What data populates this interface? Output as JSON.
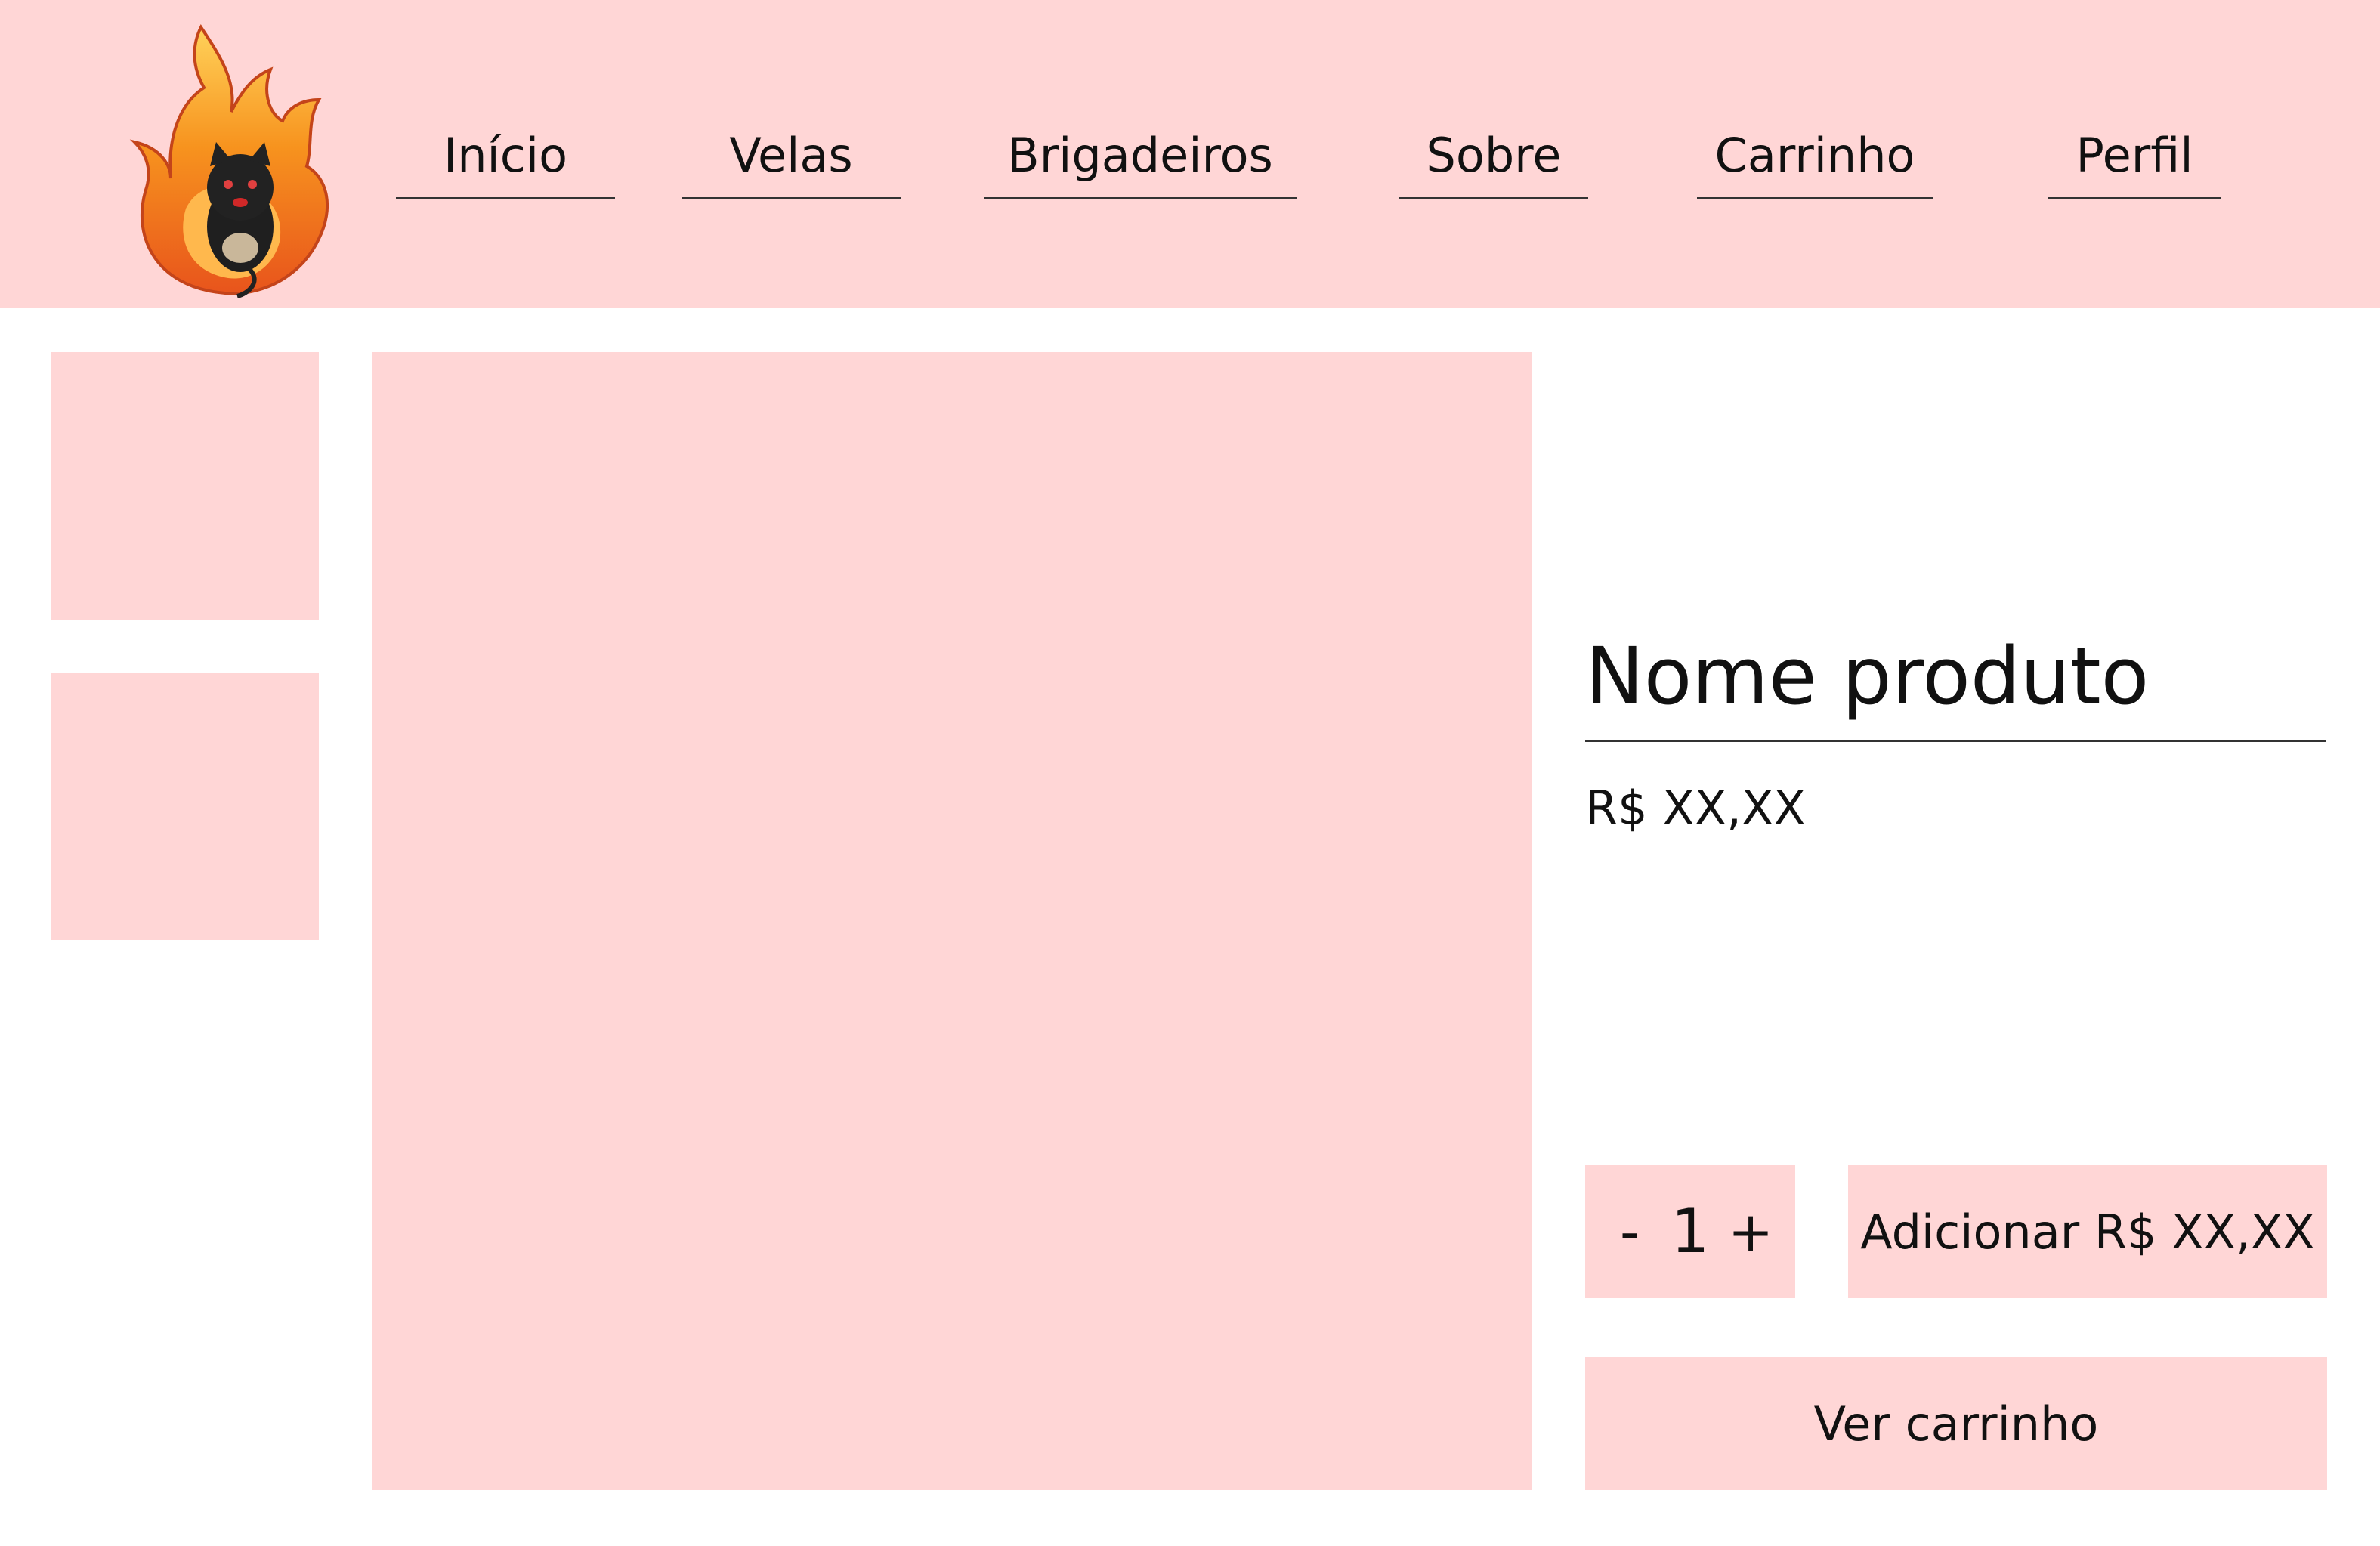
{
  "colors": {
    "accent_pink": "#ffd6d6",
    "text": "#111111",
    "underline": "#333333"
  },
  "header": {
    "logo_icon": "flaming-black-cat-logo",
    "nav": [
      {
        "label": "Início"
      },
      {
        "label": "Velas"
      },
      {
        "label": "Brigadeiros"
      },
      {
        "label": "Sobre"
      },
      {
        "label": "Carrinho"
      },
      {
        "label": "Perfil"
      }
    ]
  },
  "product": {
    "name": "Nome produto",
    "price": "R$ XX,XX"
  },
  "quantity": {
    "minus": "-",
    "value": "1",
    "plus": "+"
  },
  "actions": {
    "add_label": "Adicionar R$ XX,XX",
    "view_cart_label": "Ver carrinho"
  }
}
